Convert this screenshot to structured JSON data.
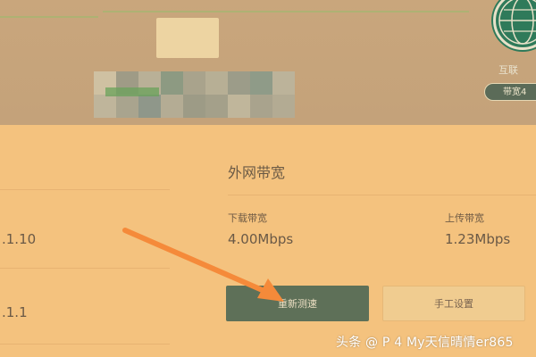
{
  "header": {
    "globe_icon": "globe-icon",
    "globe_label": "互联",
    "bandwidth_pill": "带宽4"
  },
  "wan": {
    "title": "外网带宽",
    "download": {
      "label": "下载带宽",
      "value": "4.00Mbps"
    },
    "upload": {
      "label": "上传带宽",
      "value": "1.23Mbps"
    }
  },
  "left": {
    "value1": ".1.10",
    "value2": ".1.1"
  },
  "buttons": {
    "retest": "重新测速",
    "manual": "手工设置"
  },
  "annotation": {
    "arrow_icon": "arrow-icon"
  },
  "watermark": {
    "text": "头条 @ P 4 My天信晴情er865"
  },
  "colors": {
    "accent": "#5e7058",
    "background": "#f4c27e",
    "arrow": "#f58a3a"
  }
}
